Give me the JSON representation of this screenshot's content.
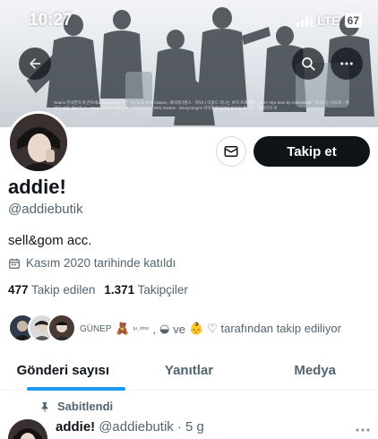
{
  "status_bar": {
    "time": "10:27",
    "network": "LTE",
    "battery": "67"
  },
  "banner": {
    "caption": "Nearis 한국말하게 만하세요 Kaokoline 나만 가나보고 Rick Owens, 세이테너랜스 · 하모니 더블드 지나는 바지 프로젝트 · 1017 Alyx 9sm by Acknowled · 하나드는 나오지 · 미하다 서울 건너가 나 · Paul Archive Fashion · 어드린이오 · Rick Owens · Wooyoungmi 아이퍼라이어의 분수인 해프리 · 세에가지 비",
    "back_icon": "arrow-left-icon",
    "search_icon": "search-icon",
    "more_icon": "more-horizontal-icon"
  },
  "profile": {
    "display_name": "addie!",
    "handle": "@addiebutik",
    "bio": "sell&gom acc.",
    "joined": "Kasım 2020 tarihinde katıldı",
    "following_count": "477",
    "following_label": "Takip edilen",
    "followers_count": "1.371",
    "followers_label": "Takipçiler",
    "follow_button": "Takip et",
    "message_icon": "mail-icon",
    "calendar_icon": "calendar-icon"
  },
  "followed_by": {
    "name1": "GÜNEP",
    "emoji1": "🧸",
    "name2": "ʲᵘ˒ᵒᵐᵉ",
    "sep": ",",
    "emoji2": "◒",
    "conj": "ve",
    "emoji3": "👶",
    "suffix": "♡ tarafından takip ediliyor"
  },
  "tabs": [
    {
      "label": "Gönderi sayısı",
      "active": true
    },
    {
      "label": "Yanıtlar",
      "active": false
    },
    {
      "label": "Medya",
      "active": false
    }
  ],
  "pinned_post": {
    "pinned_label": "Sabitlendi",
    "author_name": "addie!",
    "author_handle": "@addiebutik",
    "time": "· 5 g",
    "pin_icon": "pin-icon",
    "more_icon": "more-horizontal-icon"
  },
  "colors": {
    "accent": "#1d9bf0",
    "text_primary": "#0f1419",
    "text_secondary": "#536471",
    "button_dark": "#0f1419",
    "border": "#cfd9de"
  }
}
